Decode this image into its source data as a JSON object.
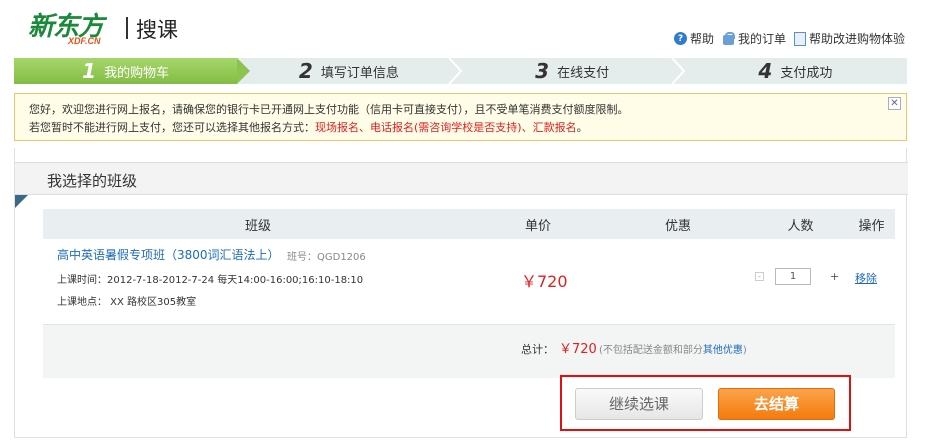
{
  "header": {
    "logo_text": "新东方",
    "logo_sub": "XDF.CN",
    "site_name": "搜课",
    "links": [
      "帮助",
      "我的订单",
      "帮助改进购物体验"
    ]
  },
  "steps": [
    {
      "num": "1",
      "label": "我的购物车",
      "active": true
    },
    {
      "num": "2",
      "label": "填写订单信息",
      "active": false
    },
    {
      "num": "3",
      "label": "在线支付",
      "active": false
    },
    {
      "num": "4",
      "label": "支付成功",
      "active": false
    }
  ],
  "notice": {
    "line1": "您好，欢迎您进行网上报名，请确保您的银行卡已开通网上支付功能（信用卡可直接支付），且不受单笔消费支付额度限制。",
    "line2_prefix": "若您暂时不能进行网上支付，您还可以选择其他报名方式：",
    "line2_options": "现场报名、电话报名(需咨询学校是否支持)、汇款报名",
    "line2_suffix": "。"
  },
  "panel": {
    "title": "我选择的班级",
    "columns": [
      "班级",
      "单价",
      "优惠",
      "人数",
      "操作"
    ],
    "course": {
      "title": "高中英语暑假专项班（3800词汇语法上）",
      "class_no": "班号：QGD1206",
      "time": "上课时间：2012-7-18-2012-7-24 每天14:00-16:00;16:10-18:10",
      "place": "上课地点： XX 路校区305教室",
      "price": "￥720",
      "quantity": "1",
      "minus": "-",
      "plus": "+",
      "remove": "移除"
    },
    "total": {
      "label": "总计：",
      "value": "￥720",
      "note_prefix": "(不包括配送金额和部分",
      "note_link": "其他优惠",
      "note_suffix": ")"
    }
  },
  "buttons": {
    "continue": "继续选课",
    "checkout": "去结算"
  },
  "colors": {
    "accent_green": "#8cc44e",
    "price_red": "#e02020",
    "link_blue": "#1e6bb8",
    "checkout_orange": "#f47b0c",
    "highlight_frame": "#e01010"
  }
}
